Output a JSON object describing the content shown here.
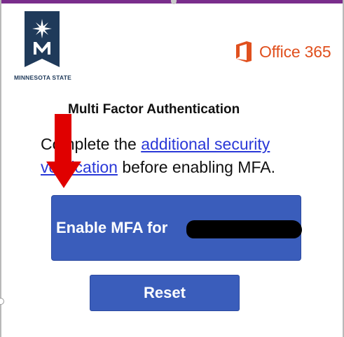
{
  "branding": {
    "university_name": "MINNESOTA STATE",
    "office_text": "Office 365",
    "colors": {
      "navy": "#1f3a5a",
      "office_orange": "#e0501e",
      "accent_purple": "#7a2e8c"
    }
  },
  "main": {
    "heading": "Multi Factor Authentication",
    "instruction_prefix": "Complete the",
    "link_text": "additional security verification",
    "instruction_suffix": "before enabling MFA.",
    "enable_button_label": "Enable MFA for",
    "reset_button_label": "Reset",
    "button_color": "#3a5dbb",
    "link_color": "#2a38d8"
  },
  "annotations": {
    "arrow_color": "#e00000"
  }
}
